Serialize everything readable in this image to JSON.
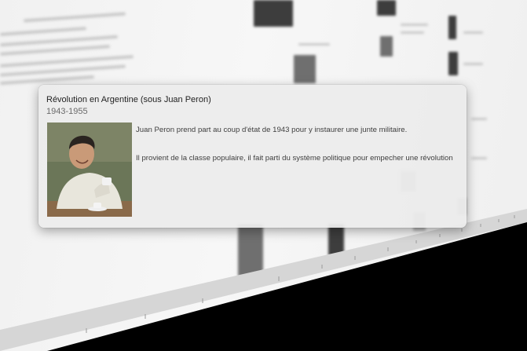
{
  "popup": {
    "title": "Révolution en Argentine (sous Juan Peron)",
    "years": "1943-1955",
    "paragraphs": [
      "Juan Peron prend part au coup d'état de 1943 pour y instaurer une junte militaire.",
      "Il provient de la classe populaire, il fait parti du système politique pour empecher une révolution"
    ],
    "photo_icon": "portrait-photo"
  },
  "colors": {
    "card_background": "#ececec",
    "floor": "#000000",
    "wall": "#f4f4f4"
  }
}
